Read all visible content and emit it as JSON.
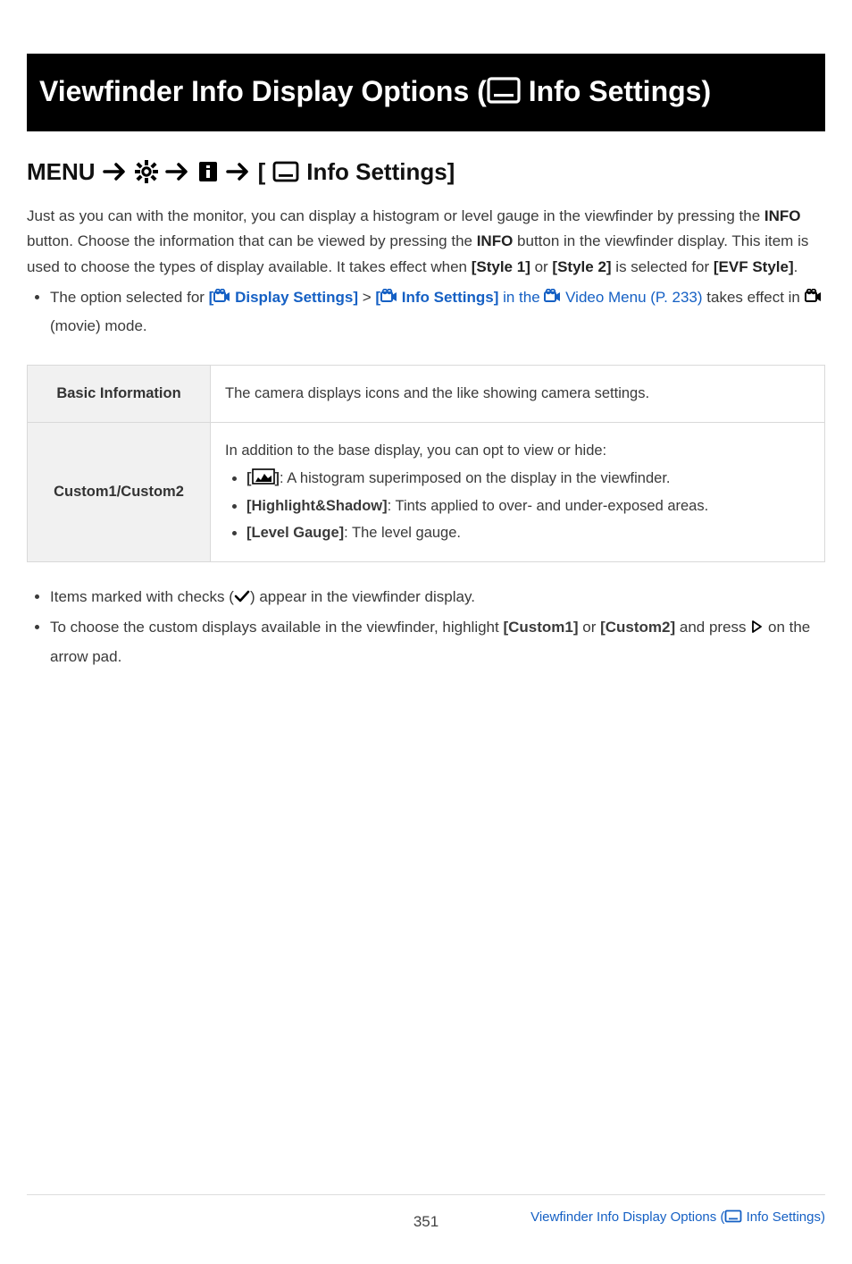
{
  "title": {
    "prefix": "Viewfinder Info Display Options (",
    "suffix_label": " Info Settings)"
  },
  "menu_heading": {
    "menu_word": "MENU",
    "bracket_open": "[",
    "label": " Info Settings]"
  },
  "intro": {
    "line1a": "Just as you can with the monitor, you can display a histogram or level gauge in the viewfinder by pressing the ",
    "info1": "INFO",
    "line1b": " button. Choose the information that can be viewed by pressing the ",
    "info2": "INFO",
    "line1c": " button in the viewfinder display. This item is used to choose the types of display available. It takes effect when ",
    "style1": "[Style 1]",
    "or_word": " or ",
    "style2": "[Style 2]",
    "sel_for": " is selected for ",
    "evf": "[EVF Style]",
    "period1": "."
  },
  "sub_bullet": {
    "prefix": "The option selected for ",
    "link1_open": "[",
    "link1_label": " Display Settings]",
    "sep": " > ",
    "link2_open": "[",
    "link2_label": " Info Settings]",
    "in_the": " in the ",
    "video_menu": " Video Menu (P. 233)",
    "tail1": " takes effect in ",
    "tail2": " (movie) mode."
  },
  "table": {
    "row1_header": "Basic Information",
    "row1_cell": "The camera displays icons and the like showing camera settings.",
    "row2_header": "Custom1/Custom2",
    "row2_intro": "In addition to the base display, you can opt to view or hide:",
    "row2_b1_open": "[",
    "row2_b1_close": "]",
    "row2_b1_rest": ": A histogram superimposed on the display in the viewfinder.",
    "row2_b2_label": "[Highlight&Shadow]",
    "row2_b2_rest": ": Tints applied to over- and under-exposed areas.",
    "row2_b3_label": "[Level Gauge]",
    "row2_b3_rest": ": The level gauge."
  },
  "below": {
    "b1a": "Items marked with checks (",
    "b1b": ") appear in the viewfinder display.",
    "b2a": "To choose the custom displays available in the viewfinder, highlight ",
    "b2_c1": "[Custom1]",
    "b2_or": " or ",
    "b2_c2": "[Custom2]",
    "b2b": " and press ",
    "b2c": " on the arrow pad."
  },
  "footer": {
    "page_number": "351",
    "link_prefix": "Viewfinder Info Display Options (",
    "link_suffix": " Info Settings)"
  }
}
